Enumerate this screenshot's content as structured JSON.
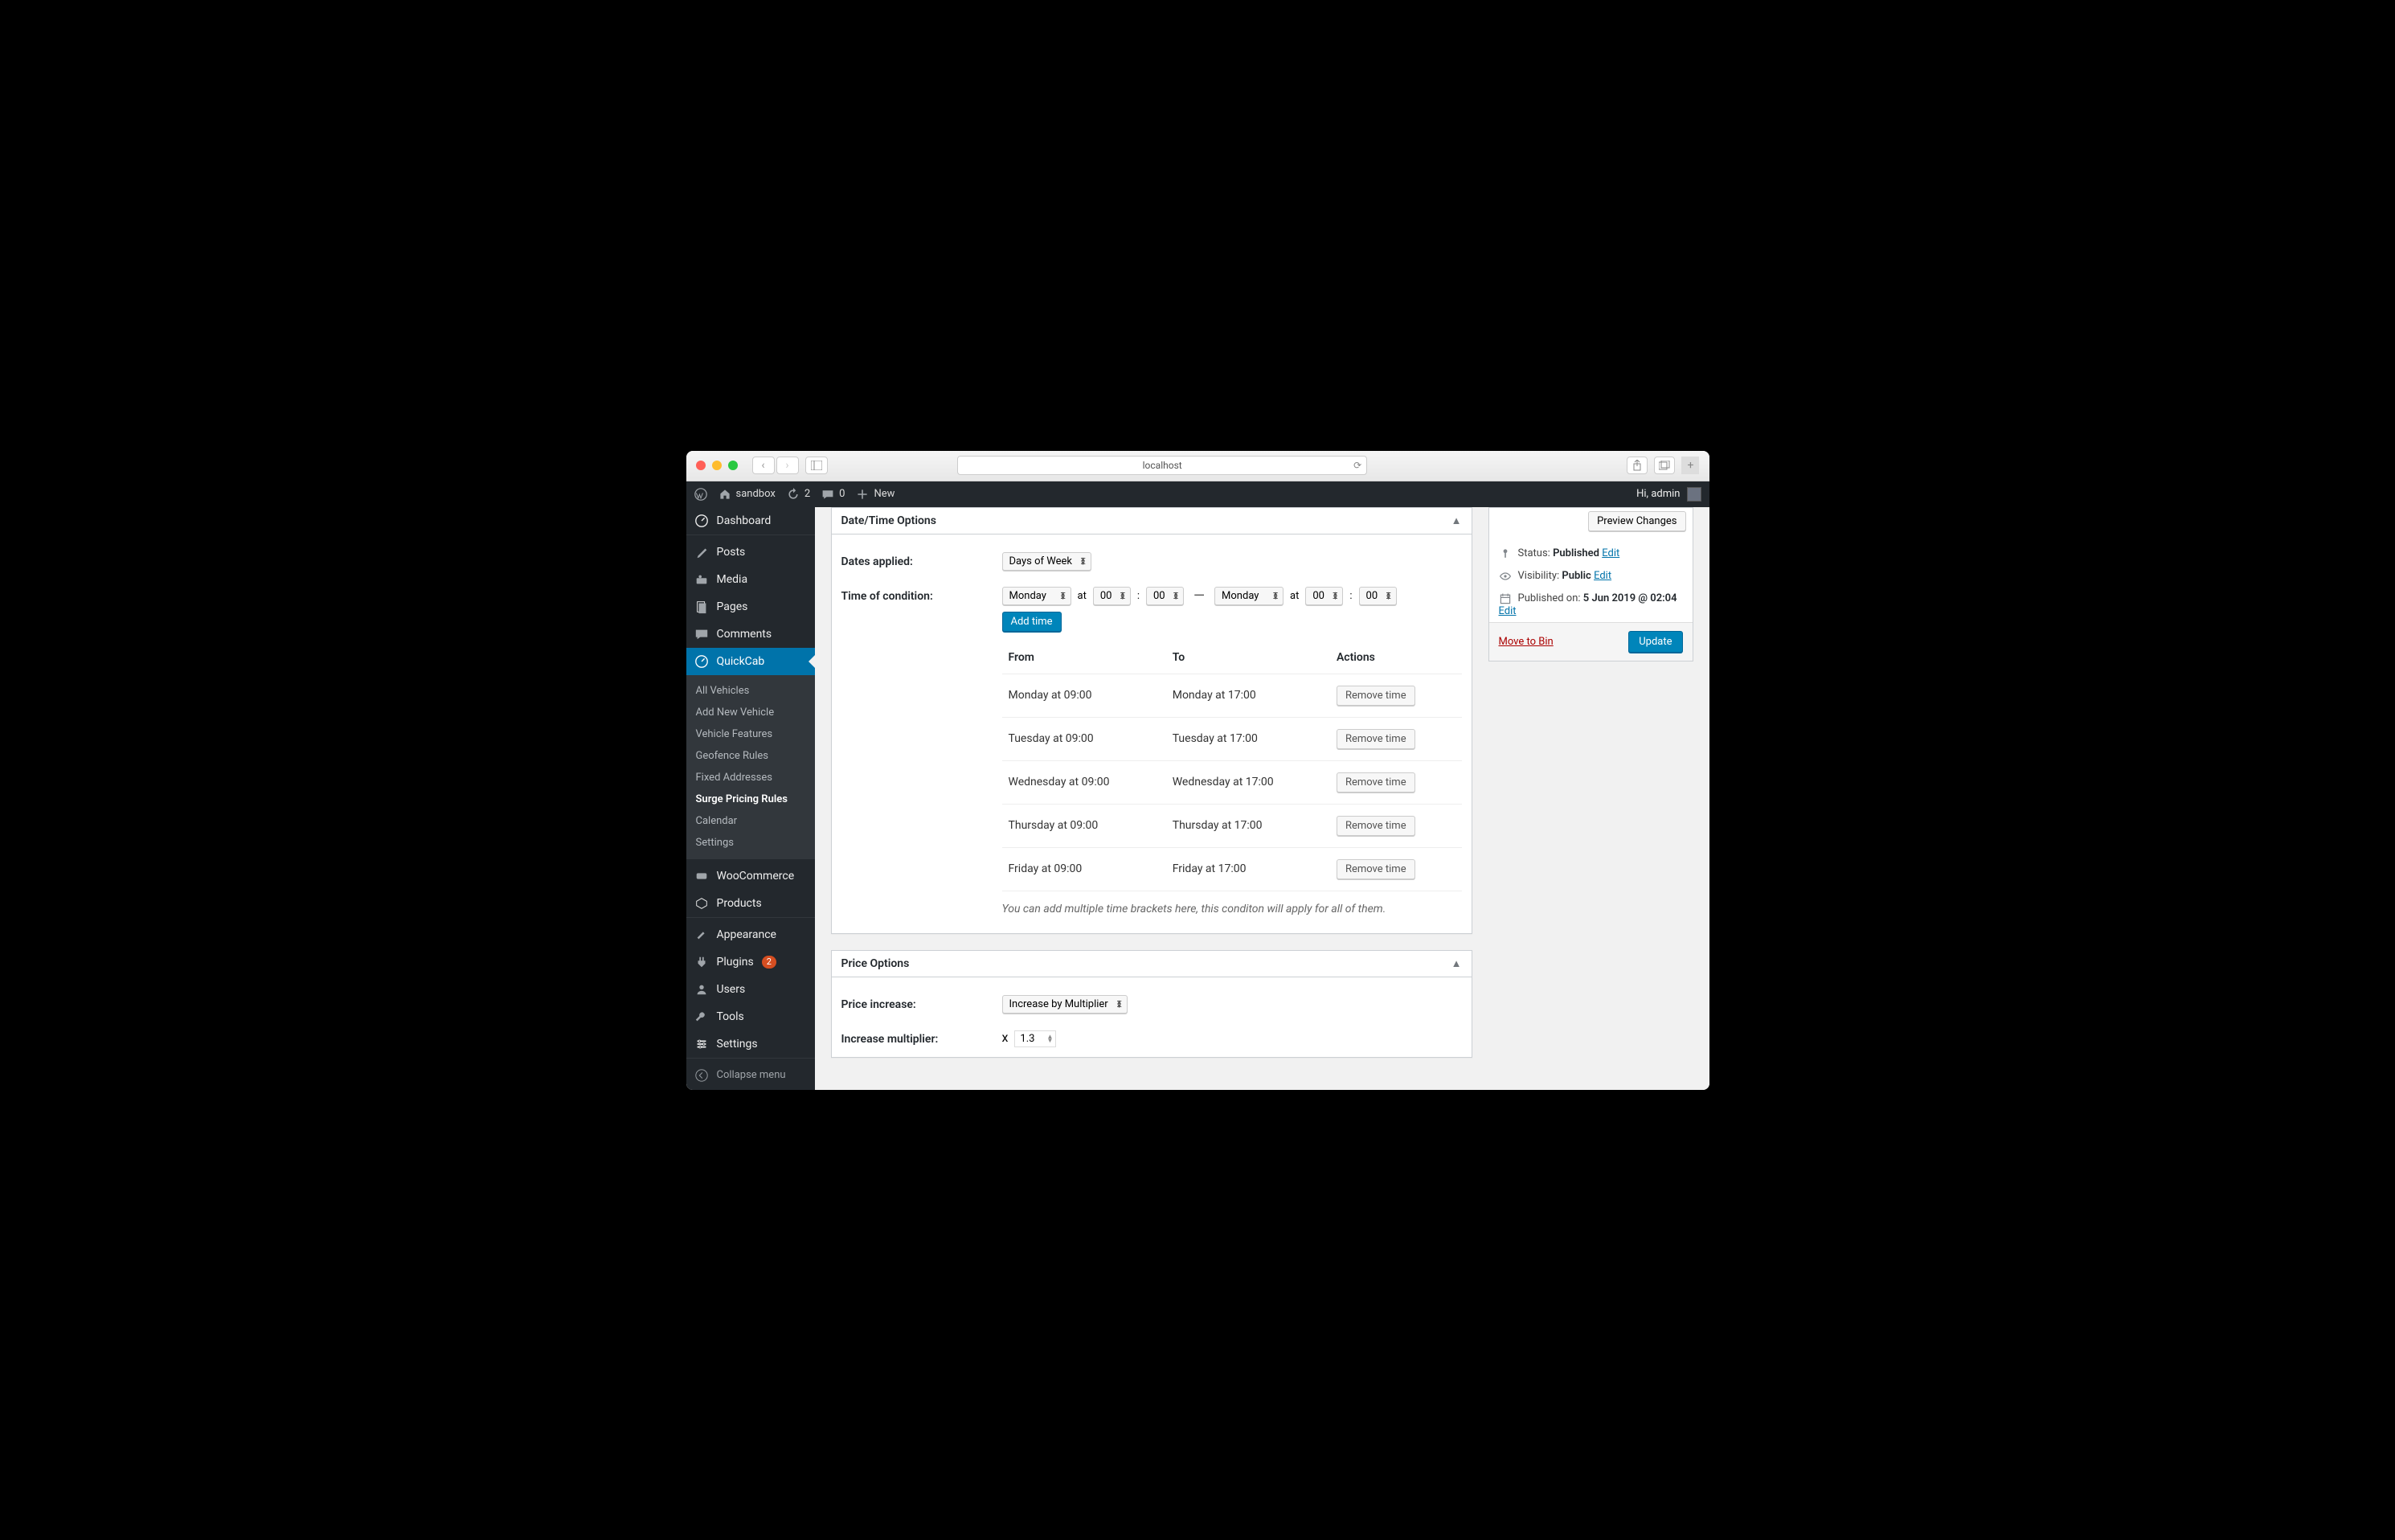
{
  "browser": {
    "url": "localhost"
  },
  "adminbar": {
    "site": "sandbox",
    "updates": "2",
    "comments": "0",
    "new": "New",
    "greeting": "Hi, admin"
  },
  "menu": {
    "dashboard": "Dashboard",
    "posts": "Posts",
    "media": "Media",
    "pages": "Pages",
    "comments": "Comments",
    "quickcab": "QuickCab",
    "quickcab_sub": {
      "all_vehicles": "All Vehicles",
      "add_new": "Add New Vehicle",
      "features": "Vehicle Features",
      "geofence": "Geofence Rules",
      "fixed": "Fixed Addresses",
      "surge": "Surge Pricing Rules",
      "calendar": "Calendar",
      "settings": "Settings"
    },
    "woocommerce": "WooCommerce",
    "products": "Products",
    "appearance": "Appearance",
    "plugins": "Plugins",
    "plugins_badge": "2",
    "users": "Users",
    "tools": "Tools",
    "settings": "Settings",
    "collapse": "Collapse menu"
  },
  "datetime_box": {
    "title": "Date/Time Options",
    "dates_applied_label": "Dates applied:",
    "dates_applied_value": "Days of Week",
    "time_condition_label": "Time of condition:",
    "day_from": "Monday",
    "at1": "at",
    "hh_from": "00",
    "mm_from": "00",
    "dash": "—",
    "day_to": "Monday",
    "at2": "at",
    "hh_to": "00",
    "mm_to": "00",
    "add_time": "Add time",
    "table": {
      "headers": {
        "from": "From",
        "to": "To",
        "actions": "Actions"
      },
      "rows": [
        {
          "from": "Monday at 09:00",
          "to": "Monday at 17:00",
          "action": "Remove time"
        },
        {
          "from": "Tuesday at 09:00",
          "to": "Tuesday at 17:00",
          "action": "Remove time"
        },
        {
          "from": "Wednesday at 09:00",
          "to": "Wednesday at 17:00",
          "action": "Remove time"
        },
        {
          "from": "Thursday at 09:00",
          "to": "Thursday at 17:00",
          "action": "Remove time"
        },
        {
          "from": "Friday at 09:00",
          "to": "Friday at 17:00",
          "action": "Remove time"
        }
      ]
    },
    "help": "You can add multiple time brackets here, this conditon will apply for all of them."
  },
  "price_box": {
    "title": "Price Options",
    "increase_label": "Price increase:",
    "increase_value": "Increase by Multiplier",
    "multiplier_label": "Increase multiplier:",
    "multiplier_prefix": "x",
    "multiplier_value": "1.3"
  },
  "publish": {
    "preview": "Preview Changes",
    "status_label": "Status:",
    "status_value": "Published",
    "visibility_label": "Visibility:",
    "visibility_value": "Public",
    "published_label": "Published on:",
    "published_value": "5 Jun 2019 @ 02:04",
    "edit": "Edit",
    "trash": "Move to Bin",
    "update": "Update"
  }
}
